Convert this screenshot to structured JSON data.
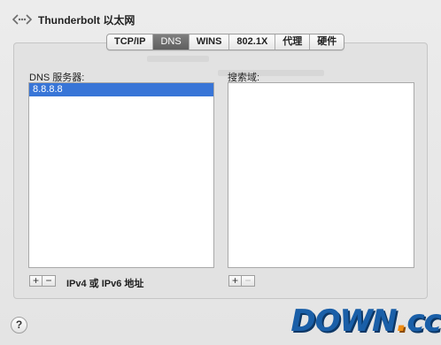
{
  "header": {
    "title": "Thunderbolt 以太网",
    "icon": "network-arrows-icon"
  },
  "tabs": [
    {
      "label": "TCP/IP",
      "active": false
    },
    {
      "label": "DNS",
      "active": true
    },
    {
      "label": "WINS",
      "active": false
    },
    {
      "label": "802.1X",
      "active": false
    },
    {
      "label": "代理",
      "active": false
    },
    {
      "label": "硬件",
      "active": false
    }
  ],
  "dns_servers": {
    "label": "DNS 服务器:",
    "items": [
      "8.8.8.8"
    ],
    "selected_index": 0,
    "add_label": "+",
    "remove_label": "−",
    "note": "IPv4 或 IPv6 地址"
  },
  "search_domains": {
    "label": "搜索域:",
    "items": [],
    "add_label": "+",
    "remove_label": "−"
  },
  "help": {
    "label": "?"
  },
  "watermark": {
    "main": "DOWN",
    "dot": ".",
    "tld": "cc"
  },
  "colors": {
    "selection": "#3875d7",
    "active_tab": "#6a6a6a",
    "watermark_blue": "#1a5fa8",
    "watermark_orange": "#f08c12"
  }
}
